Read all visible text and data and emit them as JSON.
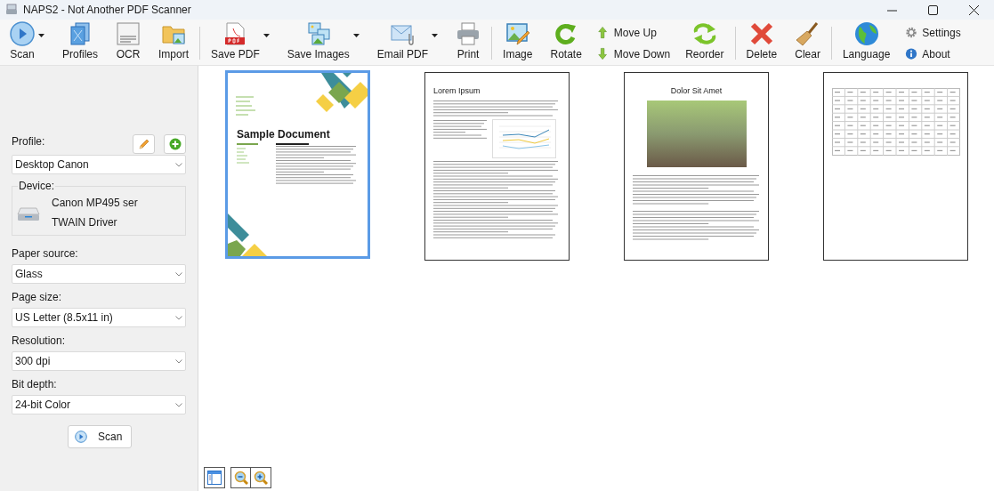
{
  "window": {
    "title": "NAPS2 - Not Another PDF Scanner"
  },
  "toolbar_groups": [
    [
      {
        "kind": "button",
        "label": "Scan",
        "dropdown": true
      },
      {
        "kind": "button",
        "label": "Profiles",
        "dropdown": false
      },
      {
        "kind": "button",
        "label": "OCR",
        "dropdown": false
      },
      {
        "kind": "button",
        "label": "Import",
        "dropdown": false
      }
    ],
    [
      {
        "kind": "button",
        "label": "Save PDF",
        "dropdown": true
      },
      {
        "kind": "button",
        "label": "Save Images",
        "dropdown": true
      },
      {
        "kind": "button",
        "label": "Email PDF",
        "dropdown": true
      },
      {
        "kind": "button",
        "label": "Print",
        "dropdown": false
      }
    ],
    [
      {
        "kind": "button",
        "label": "Image",
        "dropdown": false
      },
      {
        "kind": "button",
        "label": "Rotate",
        "dropdown": false
      },
      {
        "kind": "stack",
        "items": [
          {
            "label": "Move Up"
          },
          {
            "label": "Move Down"
          }
        ]
      },
      {
        "kind": "button",
        "label": "Reorder",
        "dropdown": false
      }
    ],
    [
      {
        "kind": "button",
        "label": "Delete",
        "dropdown": false
      },
      {
        "kind": "button",
        "label": "Clear",
        "dropdown": false
      }
    ],
    [
      {
        "kind": "button",
        "label": "Language",
        "dropdown": false
      },
      {
        "kind": "stack",
        "items": [
          {
            "label": "Settings"
          },
          {
            "label": "About"
          }
        ]
      }
    ]
  ],
  "sidebar": {
    "profile": {
      "label": "Profile:",
      "value": "Desktop Canon"
    },
    "device": {
      "label": "Device:",
      "name": "Canon MP495 ser",
      "driver": "TWAIN Driver"
    },
    "fields": [
      {
        "label": "Paper source:",
        "value": "Glass"
      },
      {
        "label": "Page size:",
        "value": "US Letter (8.5x11 in)"
      },
      {
        "label": "Resolution:",
        "value": "300 dpi"
      },
      {
        "label": "Bit depth:",
        "value": "24-bit Color"
      }
    ],
    "scan_button": "Scan"
  },
  "pages": [
    {
      "kind": "cover",
      "title": "Sample Document",
      "selected": true
    },
    {
      "kind": "text",
      "title": "Lorem Ipsum",
      "selected": false
    },
    {
      "kind": "photo",
      "title": "Dolor Sit Amet",
      "selected": false
    },
    {
      "kind": "table",
      "selected": false
    }
  ]
}
